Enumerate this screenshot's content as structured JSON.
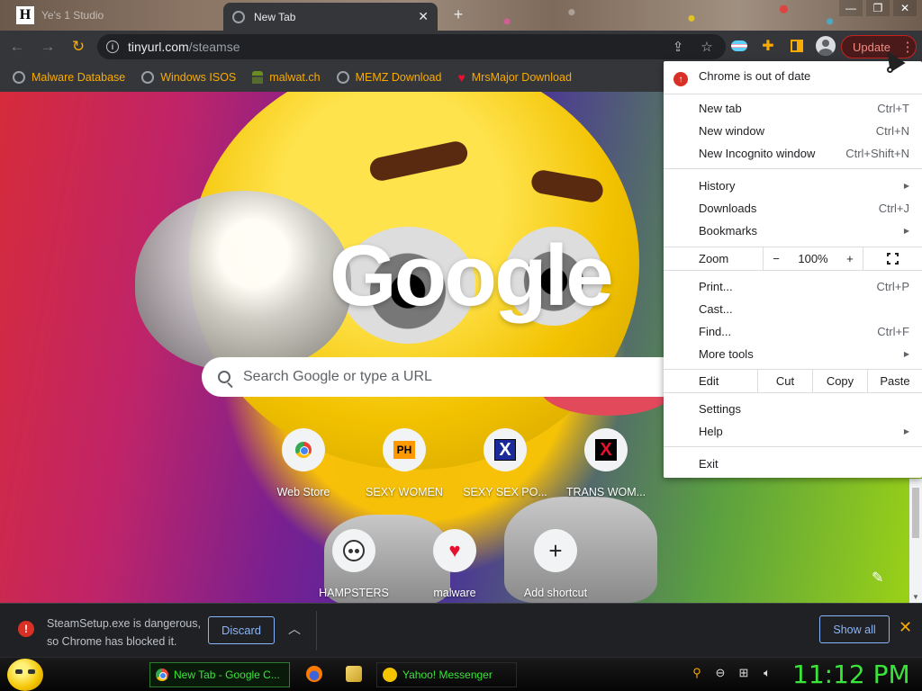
{
  "window": {
    "tabs": [
      {
        "title": "Ye's 1 Studio",
        "active": false
      },
      {
        "title": "New Tab",
        "active": true
      }
    ]
  },
  "toolbar": {
    "url_host": "tinyurl.com",
    "url_path": "/steamse",
    "update_label": "Update"
  },
  "bookmarks": [
    {
      "label": "Malware Database",
      "icon": "globe-icon"
    },
    {
      "label": "Windows ISOS",
      "icon": "globe-icon"
    },
    {
      "label": "malwat.ch",
      "icon": "figure-icon"
    },
    {
      "label": "MEMZ Download",
      "icon": "globe-icon"
    },
    {
      "label": "MrsMajor Download",
      "icon": "heart-icon"
    }
  ],
  "page": {
    "logo": "Google",
    "search_placeholder": "Search Google or type a URL",
    "shortcuts": [
      {
        "label": "Web Store"
      },
      {
        "label": "SEXY WOMEN",
        "badge": "PH"
      },
      {
        "label": "SEXY SEX PO...",
        "badge": "X"
      },
      {
        "label": "TRANS WOM...",
        "badge": "X"
      },
      {
        "label": "HAMPSTERS"
      },
      {
        "label": "malware"
      },
      {
        "label": "Add shortcut"
      }
    ]
  },
  "menu": {
    "out_of_date": "Chrome is out of date",
    "new_tab": {
      "label": "New tab",
      "key": "Ctrl+T"
    },
    "new_window": {
      "label": "New window",
      "key": "Ctrl+N"
    },
    "incognito": {
      "label": "New Incognito window",
      "key": "Ctrl+Shift+N"
    },
    "history": {
      "label": "History"
    },
    "downloads": {
      "label": "Downloads",
      "key": "Ctrl+J"
    },
    "bookmarks": {
      "label": "Bookmarks"
    },
    "zoom": {
      "label": "Zoom",
      "minus": "−",
      "level": "100%",
      "plus": "+"
    },
    "print": {
      "label": "Print...",
      "key": "Ctrl+P"
    },
    "cast": {
      "label": "Cast..."
    },
    "find": {
      "label": "Find...",
      "key": "Ctrl+F"
    },
    "more_tools": {
      "label": "More tools"
    },
    "edit": {
      "label": "Edit",
      "cut": "Cut",
      "copy": "Copy",
      "paste": "Paste"
    },
    "settings": {
      "label": "Settings"
    },
    "help": {
      "label": "Help"
    },
    "exit": {
      "label": "Exit"
    }
  },
  "download_bar": {
    "line1": "SteamSetup.exe is dangerous,",
    "line2": "so Chrome has blocked it.",
    "discard": "Discard",
    "show_all": "Show all"
  },
  "taskbar": {
    "items": [
      {
        "label": "New Tab - Google C..."
      },
      {
        "label": "Yahoo! Messenger"
      }
    ],
    "clock": "11:12 PM"
  },
  "colors": {
    "accent": "#f9ab00",
    "update_red": "#c5221f",
    "taskbar_green": "#39e539",
    "link_blue": "#8ab4f8"
  }
}
